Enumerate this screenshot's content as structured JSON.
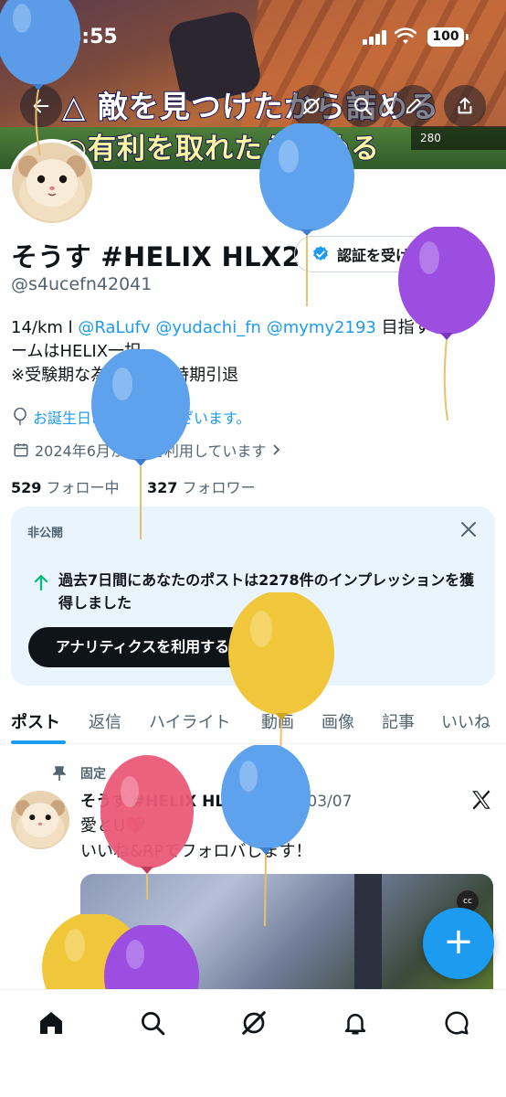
{
  "status_bar": {
    "time": "6:55",
    "battery": "100"
  },
  "banner": {
    "caption_line1": "△ 敵を見つけたから詰める",
    "caption_line2": "◎有利を取れたら詰める",
    "hud_text": "280"
  },
  "profile": {
    "name": "そうす #HELIX HLX2",
    "handle": "@s4ucefn42041",
    "verify_button": "認証を受ける",
    "bio_line1_prefix": "14/km l ",
    "bio_mentions": [
      "@RaLufv",
      "@yudachi_fn",
      "@mymy2193"
    ],
    "bio_line1_suffix": " 目指すチ",
    "bio_line2": "ームはHELIX一択",
    "bio_line3": "※受験期な為競技は一時期引退",
    "birthday": "お誕生日おめでとうございます。",
    "joined": "2024年6月からXを利用しています",
    "following_count": "529",
    "following_label": "フォロー中",
    "followers_count": "327",
    "followers_label": "フォロワー"
  },
  "private_card": {
    "label": "非公開",
    "message": "過去7日間にあなたのポストは2278件のインプレッションを獲得しました",
    "cta": "アナリティクスを利用する"
  },
  "tabs": [
    "ポスト",
    "返信",
    "ハイライト",
    "動画",
    "画像",
    "記事",
    "いいね"
  ],
  "active_tab": "ポスト",
  "pinned_post": {
    "pinned_label": "固定",
    "author": "そうす #HELIX HLX2",
    "date": "· 2026/03/07",
    "line1": "愛とU💖",
    "line2": "いいね&RPでフォロバします！",
    "media_badge": "cc"
  },
  "fab_label": "+",
  "bottom_nav": [
    "home-icon",
    "search-icon",
    "grok-icon",
    "notifications-icon",
    "messages-icon"
  ],
  "colors": {
    "accent": "#1d9bf0",
    "text": "#0f1419",
    "muted": "#536471",
    "card_bg": "#eaf4fc"
  }
}
